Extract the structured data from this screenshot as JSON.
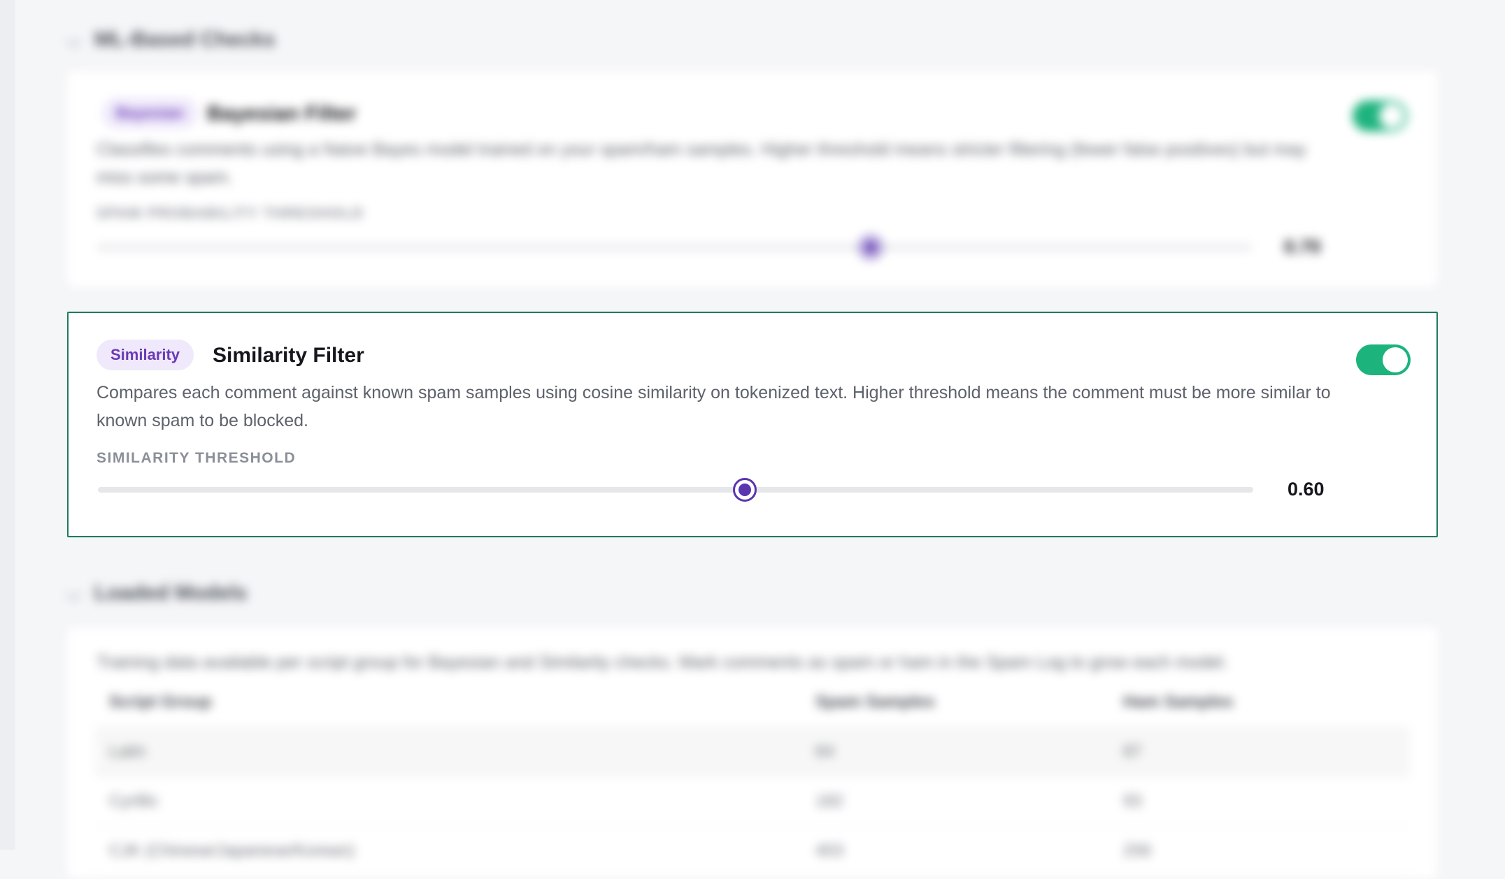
{
  "top_section": {
    "title": "ML-Based Checks",
    "card": {
      "badge": "Bayesian",
      "title": "Bayesian Filter",
      "description": "Classifies comments using a Naive Bayes model trained on your spam/ham samples. Higher threshold means stricter filtering (fewer false positives) but may miss some spam.",
      "field_label": "SPAM PROBABILITY THRESHOLD",
      "value": "0.70",
      "slider_fraction": 0.67,
      "enabled": true
    }
  },
  "similarity_card": {
    "badge": "Similarity",
    "title": "Similarity Filter",
    "description": "Compares each comment against known spam samples using cosine similarity on tokenized text. Higher threshold means the comment must be more similar to known spam to be blocked.",
    "field_label": "SIMILARITY THRESHOLD",
    "value": "0.60",
    "slider_fraction": 0.56,
    "enabled": true
  },
  "bottom_section": {
    "title": "Loaded Models",
    "description": "Training data available per script group for Bayesian and Similarity checks. Mark comments as spam or ham in the Spam Log to grow each model.",
    "columns": [
      "Script Group",
      "Spam Samples",
      "Ham Samples"
    ],
    "rows": [
      [
        "Latin",
        "64",
        "87"
      ],
      [
        "Cyrillic",
        "182",
        "93"
      ],
      [
        "CJK (Chinese/Japanese/Korean)",
        "403",
        "256"
      ]
    ]
  },
  "colors": {
    "accent": "#5b34b0",
    "toggle_on": "#1db37d",
    "card_border": "#1f7a5f",
    "badge_bg": "#efe9fb"
  }
}
